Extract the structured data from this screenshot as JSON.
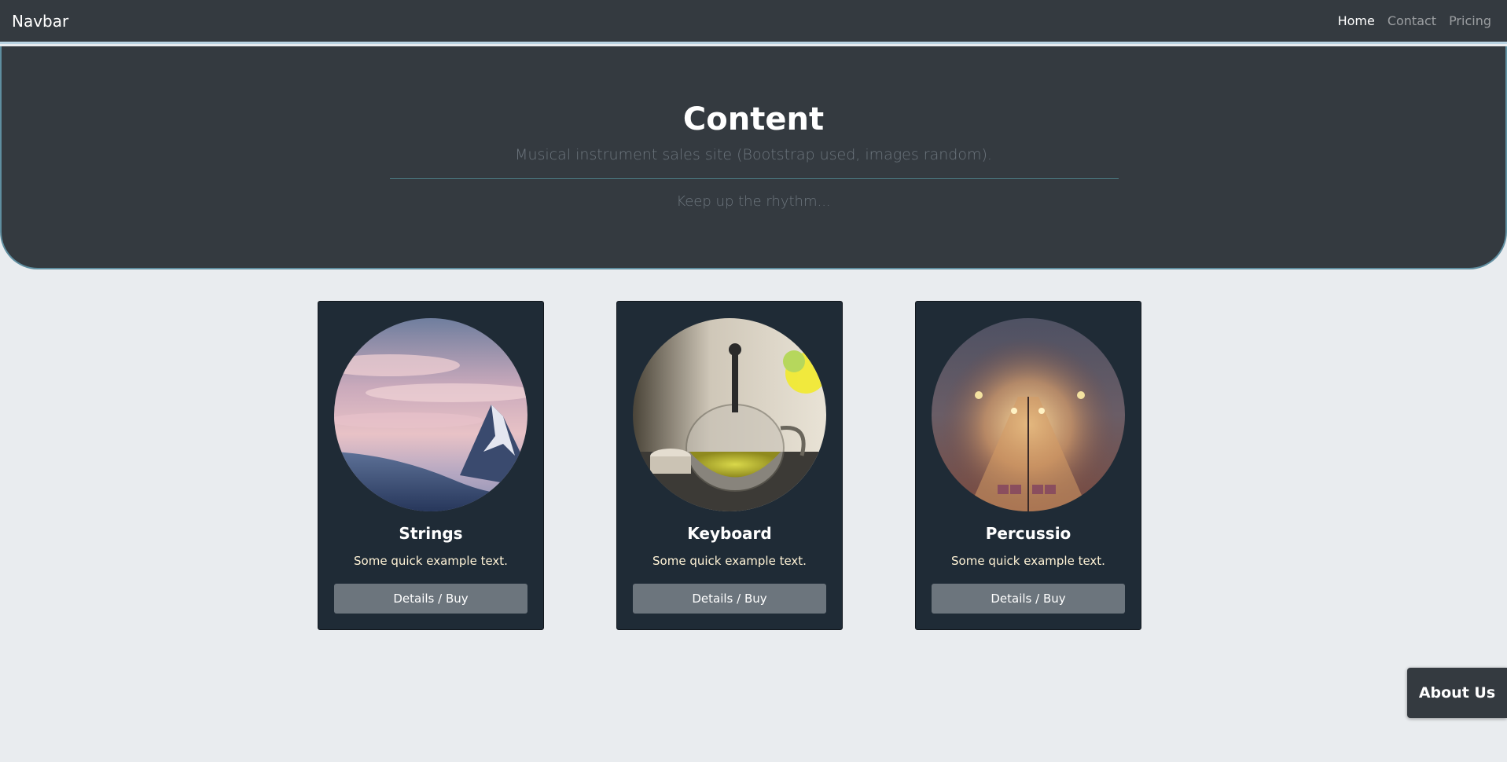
{
  "navbar": {
    "brand": "Navbar",
    "links": [
      {
        "label": "Home",
        "active": true
      },
      {
        "label": "Contact",
        "active": false
      },
      {
        "label": "Pricing",
        "active": false
      }
    ]
  },
  "jumbotron": {
    "title": "Content",
    "lead": "Musical instrument sales site (Bootstrap used, images random).",
    "sub": "Keep up the rhythm..."
  },
  "cards": [
    {
      "title": "Strings",
      "text": "Some quick example text.",
      "button": "Details / Buy",
      "image": "snowy-mountain-sunset-photo"
    },
    {
      "title": "Keyboard",
      "text": "Some quick example text.",
      "button": "Details / Buy",
      "image": "teapot-on-table-photo"
    },
    {
      "title": "Percussio",
      "text": "Some quick example text.",
      "button": "Details / Buy",
      "image": "foggy-railway-lights-photo"
    }
  ],
  "about_button": "About Us",
  "colors": {
    "page_bg": "#e9ecef",
    "dark": "#343a40",
    "card_bg": "#1f2b36",
    "button_gray": "#6c757d",
    "border_accent": "#5f8ea0"
  }
}
